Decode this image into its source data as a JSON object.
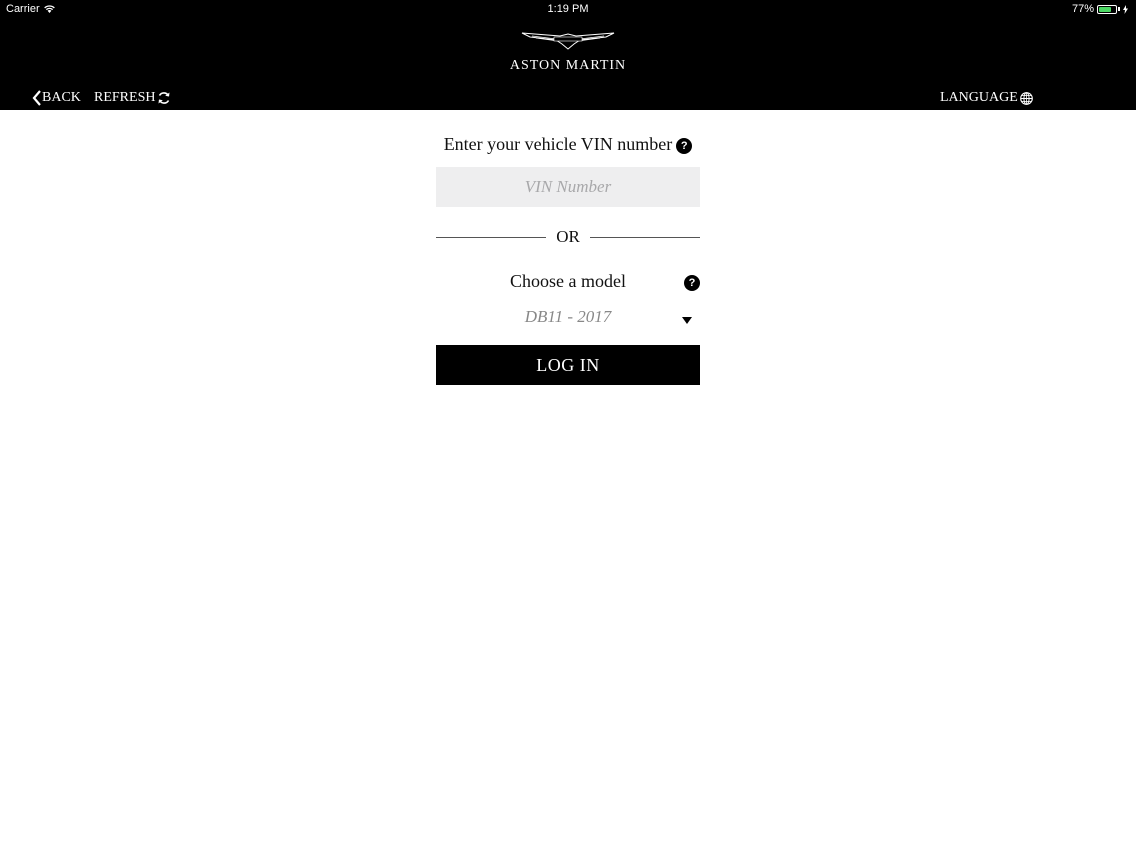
{
  "status_bar": {
    "carrier": "Carrier",
    "time": "1:19 PM",
    "battery_percent": "77%",
    "battery_level": 0.77,
    "battery_color": "#4cd964"
  },
  "brand": {
    "name": "ASTON MARTIN",
    "logo_icon": "aston-martin-wings-logo"
  },
  "nav": {
    "back_label": "BACK",
    "back_icon": "chevron-left-icon",
    "refresh_label": "REFRESH",
    "refresh_icon": "refresh-icon",
    "language_label": "LANGUAGE",
    "language_icon": "globe-icon"
  },
  "form": {
    "vin_label": "Enter your vehicle VIN number",
    "vin_placeholder": "VIN Number",
    "vin_value": "",
    "help_glyph": "?",
    "or_label": "OR",
    "model_label": "Choose a model",
    "model_selected": "DB11 - 2017",
    "login_label": "LOG IN"
  },
  "colors": {
    "header_bg": "#000000",
    "input_bg": "#eeeeef",
    "button_bg": "#000000"
  }
}
